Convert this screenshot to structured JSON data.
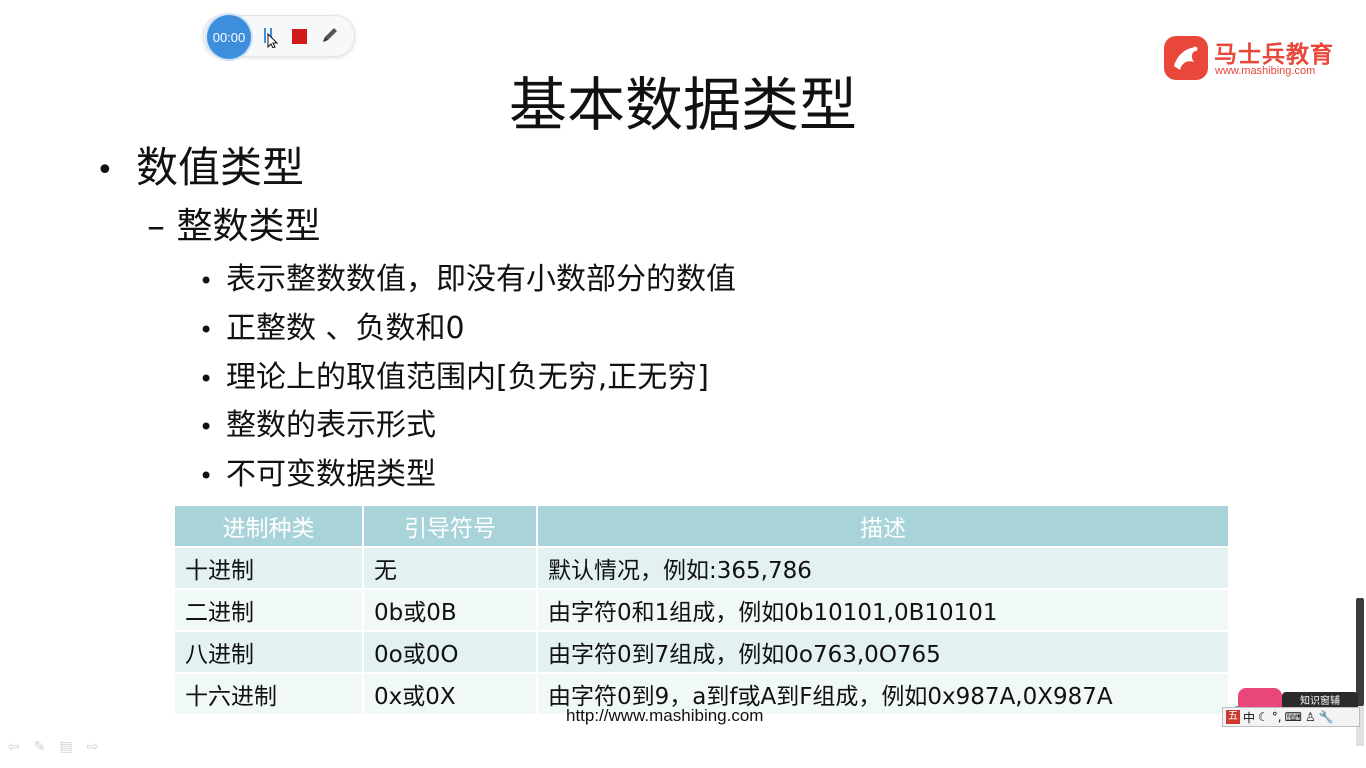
{
  "recorder": {
    "timer": "00:00"
  },
  "logo": {
    "name": "马士兵教育",
    "url": "www.mashibing.com"
  },
  "slide": {
    "title": "基本数据类型",
    "level1": "数值类型",
    "level2": "整数类型",
    "bullets": [
      "表示整数数值，即没有小数部分的数值",
      "正整数 、负数和0",
      "理论上的取值范围内[负无穷,正无穷]",
      "整数的表示形式",
      "不可变数据类型"
    ]
  },
  "table": {
    "headers": [
      "进制种类",
      "引导符号",
      "描述"
    ],
    "rows": [
      [
        "十进制",
        "无",
        "默认情况，例如:365,786"
      ],
      [
        "二进制",
        "0b或0B",
        "由字符0和1组成，例如0b10101,0B10101"
      ],
      [
        "八进制",
        "0o或0O",
        "由字符0到7组成，例如0o763,0O765"
      ],
      [
        "十六进制",
        "0x或0X",
        "由字符0到9，a到f或A到F组成，例如0x987A,0X987A"
      ]
    ]
  },
  "footer": {
    "url": "http://www.mashibing.com"
  },
  "ime": {
    "mode": "中",
    "badge": "知识窗辅"
  },
  "colors": {
    "brand": "#e8473a",
    "table_header": "#a8d3d8",
    "row_odd": "#e3f1f2",
    "row_even": "#f1f8f8",
    "stop": "#d11a1a",
    "timer": "#3d8fdd"
  }
}
